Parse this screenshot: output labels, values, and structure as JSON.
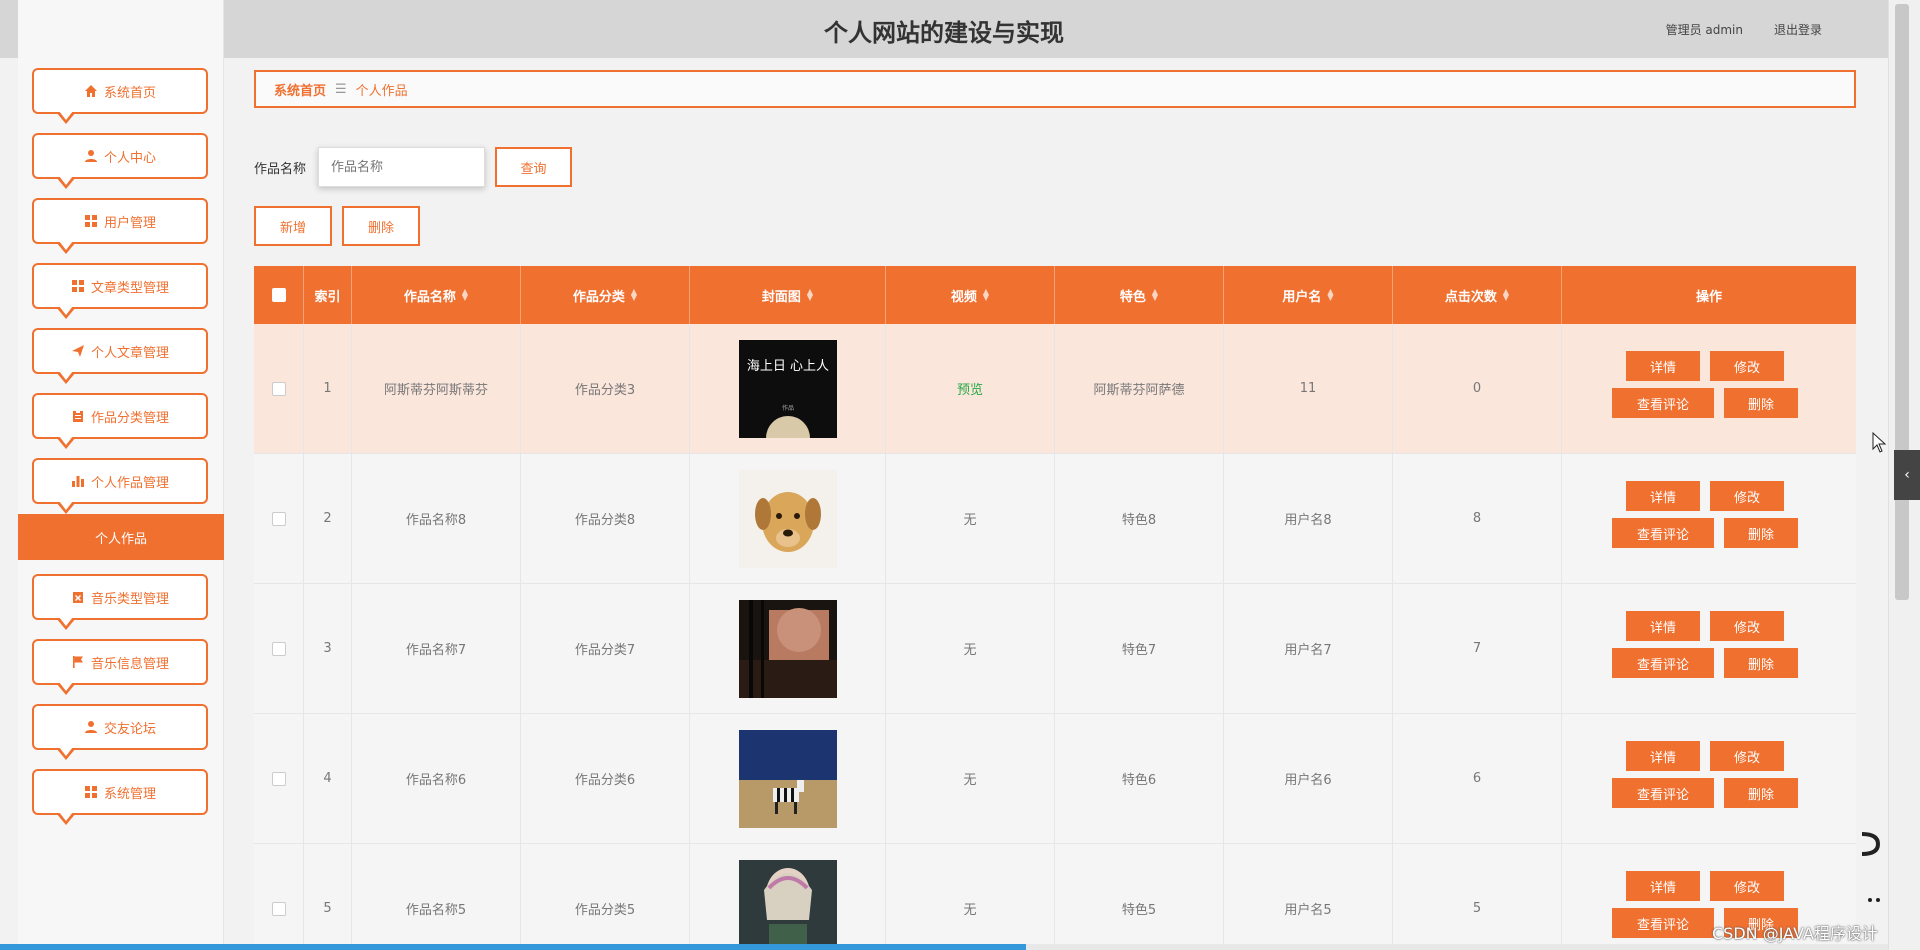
{
  "header": {
    "title": "个人网站的建设与实现",
    "user": "管理员 admin",
    "logout": "退出登录"
  },
  "sidebar": {
    "items": [
      {
        "label": "系统首页",
        "icon": "home-icon"
      },
      {
        "label": "个人中心",
        "icon": "user-icon"
      },
      {
        "label": "用户管理",
        "icon": "grid-icon"
      },
      {
        "label": "文章类型管理",
        "icon": "grid-icon"
      },
      {
        "label": "个人文章管理",
        "icon": "send-icon"
      },
      {
        "label": "作品分类管理",
        "icon": "clipboard-icon"
      },
      {
        "label": "个人作品管理",
        "icon": "bar-chart-icon"
      },
      {
        "label": "音乐类型管理",
        "icon": "clipboard-x-icon"
      },
      {
        "label": "音乐信息管理",
        "icon": "flag-icon"
      },
      {
        "label": "交友论坛",
        "icon": "user-icon"
      },
      {
        "label": "系统管理",
        "icon": "grid-icon"
      }
    ],
    "active_sub": "个人作品"
  },
  "breadcrumb": {
    "home": "系统首页",
    "separator": "☰",
    "current": "个人作品"
  },
  "search": {
    "label": "作品名称",
    "placeholder": "作品名称",
    "query_button": "查询"
  },
  "actions": {
    "add": "新增",
    "delete": "删除"
  },
  "table": {
    "headers": [
      "索引",
      "作品名称",
      "作品分类",
      "封面图",
      "视频",
      "特色",
      "用户名",
      "点击次数",
      "操作"
    ],
    "rows": [
      {
        "index": "1",
        "name": "阿斯蒂芬阿斯蒂芬",
        "category": "作品分类3",
        "cover": "book-cover",
        "video": "预览",
        "feature": "阿斯蒂芬阿萨德",
        "username": "11",
        "clicks": "0"
      },
      {
        "index": "2",
        "name": "作品名称8",
        "category": "作品分类8",
        "cover": "dog",
        "video": "无",
        "feature": "特色8",
        "username": "用户名8",
        "clicks": "8"
      },
      {
        "index": "3",
        "name": "作品名称7",
        "category": "作品分类7",
        "cover": "autumn-scene",
        "video": "无",
        "feature": "特色7",
        "username": "用户名7",
        "clicks": "7"
      },
      {
        "index": "4",
        "name": "作品名称6",
        "category": "作品分类6",
        "cover": "zebra",
        "video": "无",
        "feature": "特色6",
        "username": "用户名6",
        "clicks": "6"
      },
      {
        "index": "5",
        "name": "作品名称5",
        "category": "作品分类5",
        "cover": "portrait",
        "video": "无",
        "feature": "特色5",
        "username": "用户名5",
        "clicks": "5"
      }
    ],
    "row_buttons": {
      "detail": "详情",
      "edit": "修改",
      "comments": "查看评论",
      "delete": "删除"
    }
  },
  "cover_text": {
    "title": "海上日 心上人",
    "subtitle": "作品"
  },
  "watermark": "CSDN @JAVA程序设计",
  "colors": {
    "accent": "#f07030",
    "highlight_row": "#fbe6dc",
    "video_link": "#28a745"
  }
}
